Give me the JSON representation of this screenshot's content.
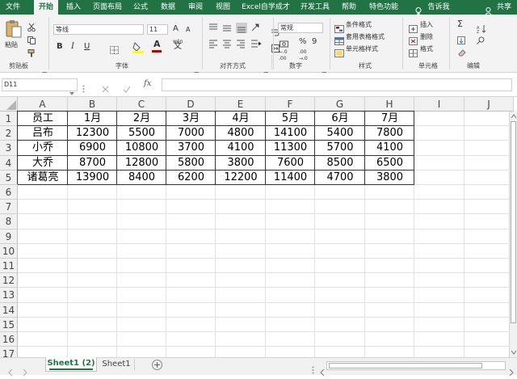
{
  "menu": {
    "tabs": [
      "文件",
      "开始",
      "插入",
      "页面布局",
      "公式",
      "数据",
      "审阅",
      "视图",
      "Excel自学成才",
      "开发工具",
      "帮助",
      "特色功能"
    ],
    "active": "开始",
    "tell_me": "告诉我",
    "share": "共享"
  },
  "ribbon": {
    "clipboard": {
      "paste": "粘贴",
      "label": "剪贴板"
    },
    "font": {
      "name": "等线",
      "size": "11",
      "bold": "B",
      "italic": "I",
      "underline": "U",
      "grow": "A",
      "shrink": "A",
      "color_a": "A",
      "pinyin": "wén",
      "label": "字体",
      "red": "#c00000",
      "yellow": "#ffff00"
    },
    "alignment": {
      "label": "对齐方式"
    },
    "number": {
      "format": "常规",
      "percent": "%",
      "comma": "9",
      "label": "数字",
      "decimals_up": "←.0 .00",
      "decimals_down": ".00 →.0"
    },
    "styles": {
      "conditional": "条件格式",
      "table": "套用表格格式",
      "cell": "单元格样式",
      "label": "样式"
    },
    "cells": {
      "insert": "插入",
      "delete": "删除",
      "format": "格式",
      "label": "单元格"
    },
    "editing": {
      "label": "编辑",
      "sigma": "Σ"
    }
  },
  "formula_bar": {
    "name_box": "D11",
    "fx": "fx",
    "value": ""
  },
  "sheet": {
    "columns": [
      "A",
      "B",
      "C",
      "D",
      "E",
      "F",
      "G",
      "H",
      "I",
      "J"
    ],
    "row_numbers": [
      "1",
      "2",
      "3",
      "4",
      "5",
      "6",
      "7",
      "8",
      "9",
      "10",
      "11",
      "12",
      "13",
      "14",
      "15",
      "16",
      "17"
    ],
    "rows": [
      [
        "员工",
        "1月",
        "2月",
        "3月",
        "4月",
        "5月",
        "6月",
        "7月"
      ],
      [
        "吕布",
        "12300",
        "5500",
        "7000",
        "4800",
        "14100",
        "5400",
        "7800"
      ],
      [
        "小乔",
        "6900",
        "10800",
        "3700",
        "4100",
        "11300",
        "5700",
        "4100"
      ],
      [
        "大乔",
        "8700",
        "12800",
        "5800",
        "3800",
        "7600",
        "8500",
        "6500"
      ],
      [
        "诸葛亮",
        "13900",
        "8400",
        "6200",
        "12200",
        "11400",
        "4700",
        "3800"
      ]
    ]
  },
  "tabs": {
    "sheets": [
      "Sheet1 (2)",
      "Sheet1"
    ],
    "active": "Sheet1 (2)",
    "add": "+"
  },
  "colors": {
    "brand": "#217346",
    "grid": "#d4d4d4"
  }
}
